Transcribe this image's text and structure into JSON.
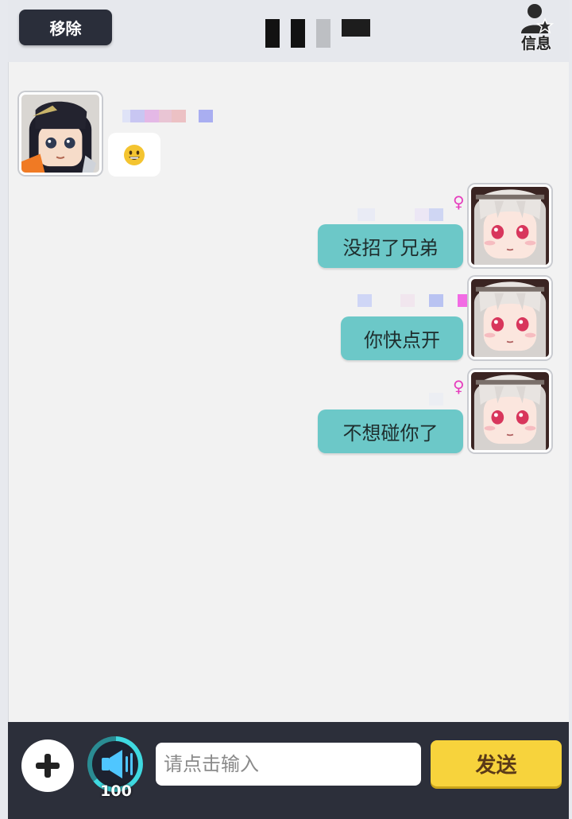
{
  "header": {
    "remove_label": "移除",
    "info_label": "信息"
  },
  "messages": [
    {
      "side": "left",
      "type": "emoji",
      "text": "😀",
      "avatar": "anime-dark-hair-avatar"
    },
    {
      "side": "right",
      "text": "没招了兄弟",
      "gender": "♀",
      "avatar": "anime-silver-hair-avatar"
    },
    {
      "side": "right",
      "text": "你快点开",
      "avatar": "anime-silver-hair-avatar"
    },
    {
      "side": "right",
      "text": "不想碰你了",
      "gender": "♀",
      "avatar": "anime-silver-hair-avatar"
    }
  ],
  "input_bar": {
    "placeholder": "请点击输入",
    "send_label": "发送",
    "voice_count": "100"
  },
  "colors": {
    "bubble_right": "#6cc8c8",
    "send_button": "#f7d33c",
    "bottom_bar": "#2c2f3a",
    "female_icon": "#e63cbd"
  }
}
